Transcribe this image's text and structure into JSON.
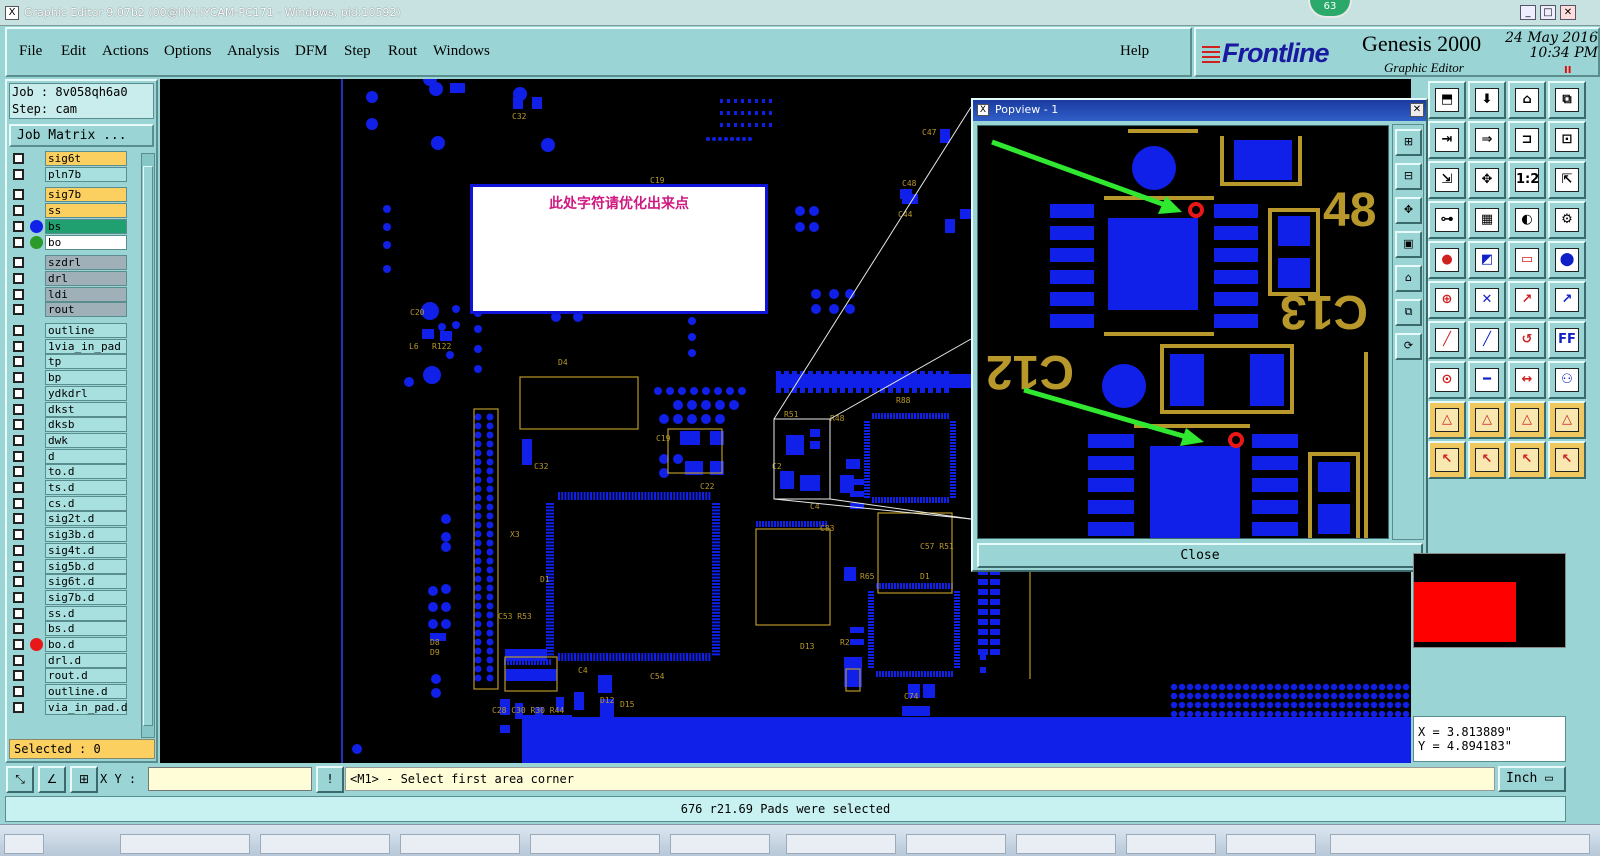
{
  "window": {
    "title": "Graphic Editor 9.07b2 (00@HY-HYCAM-PC171 - Windows, pid:10592)",
    "sys_icon": "x-logo-icon",
    "minimize": "_",
    "maximize": "□",
    "close": "✕",
    "badge": "63"
  },
  "menu": {
    "items": [
      "File",
      "Edit",
      "Actions",
      "Options",
      "Analysis",
      "DFM",
      "Step",
      "Rout",
      "Windows"
    ],
    "help": "Help"
  },
  "brand": {
    "logo": "Frontline",
    "product": "Genesis 2000",
    "subtitle": "Graphic Editor",
    "date": "24 May 2016",
    "time": "10:34 PM",
    "indicator": "II"
  },
  "job": {
    "job_line": "Job : 8v058qh6a0",
    "step_line": "Step: cam",
    "matrix_button": "Job Matrix ...",
    "selected": "Selected : 0"
  },
  "layers": [
    {
      "name": "sig6t",
      "color": "#fcd060",
      "dot": ""
    },
    {
      "name": "pln7b",
      "color": "#a8e0e0",
      "dot": ""
    },
    {
      "name": "sig7b",
      "color": "#fcd060",
      "dot": ""
    },
    {
      "name": "ss",
      "color": "#fcd060",
      "dot": ""
    },
    {
      "name": "bs",
      "color": "#20a070",
      "dot": "#1020e8"
    },
    {
      "name": "bo",
      "color": "#ffffff",
      "dot": "#2a9a2a"
    },
    {
      "name": "szdrl",
      "color": "#a0b0b8",
      "dot": ""
    },
    {
      "name": "drl",
      "color": "#a0b0b8",
      "dot": ""
    },
    {
      "name": "ldi",
      "color": "#a0b0b8",
      "dot": ""
    },
    {
      "name": "rout",
      "color": "#a0b0b8",
      "dot": ""
    },
    {
      "name": "outline",
      "color": "#a8e0e0",
      "dot": ""
    },
    {
      "name": "1via_in_pad",
      "color": "#a8e0e0",
      "dot": ""
    },
    {
      "name": "tp",
      "color": "#a8e0e0",
      "dot": ""
    },
    {
      "name": "bp",
      "color": "#a8e0e0",
      "dot": ""
    },
    {
      "name": "ydkdrl",
      "color": "#a8e0e0",
      "dot": ""
    },
    {
      "name": "dkst",
      "color": "#a8e0e0",
      "dot": ""
    },
    {
      "name": "dksb",
      "color": "#a8e0e0",
      "dot": ""
    },
    {
      "name": "dwk",
      "color": "#a8e0e0",
      "dot": ""
    },
    {
      "name": "d",
      "color": "#a8e0e0",
      "dot": ""
    },
    {
      "name": "to.d",
      "color": "#a8e0e0",
      "dot": ""
    },
    {
      "name": "ts.d",
      "color": "#a8e0e0",
      "dot": ""
    },
    {
      "name": "cs.d",
      "color": "#a8e0e0",
      "dot": ""
    },
    {
      "name": "sig2t.d",
      "color": "#a8e0e0",
      "dot": ""
    },
    {
      "name": "sig3b.d",
      "color": "#a8e0e0",
      "dot": ""
    },
    {
      "name": "sig4t.d",
      "color": "#a8e0e0",
      "dot": ""
    },
    {
      "name": "sig5b.d",
      "color": "#a8e0e0",
      "dot": ""
    },
    {
      "name": "sig6t.d",
      "color": "#a8e0e0",
      "dot": ""
    },
    {
      "name": "sig7b.d",
      "color": "#a8e0e0",
      "dot": ""
    },
    {
      "name": "ss.d",
      "color": "#a8e0e0",
      "dot": ""
    },
    {
      "name": "bs.d",
      "color": "#a8e0e0",
      "dot": ""
    },
    {
      "name": "bo.d",
      "color": "#a8e0e0",
      "dot": "#e81818"
    },
    {
      "name": "drl.d",
      "color": "#a8e0e0",
      "dot": ""
    },
    {
      "name": "rout.d",
      "color": "#a8e0e0",
      "dot": ""
    },
    {
      "name": "outline.d",
      "color": "#a8e0e0",
      "dot": ""
    },
    {
      "name": "via_in_pad.d",
      "color": "#a8e0e0",
      "dot": ""
    }
  ],
  "canvas": {
    "note": "此处字符请优化出来点",
    "pad_color": "#1020e8",
    "silk_color": "#b8982a"
  },
  "popview": {
    "title": "Popview - 1",
    "close_label": "Close",
    "labels": {
      "c12": "C12",
      "c13": "C13",
      "num": "48"
    },
    "arrow_color": "#30e830",
    "marker_color": "#e81818"
  },
  "coords": {
    "x": "X = 3.813889\"",
    "y": "Y = 4.894183\""
  },
  "bottom": {
    "xy_label": "X Y :",
    "xy_value": "",
    "alert_icon": "!",
    "message": "<M1> - Select first area corner",
    "unit": "Inch",
    "status": "676 r21.69 Pads were selected"
  }
}
